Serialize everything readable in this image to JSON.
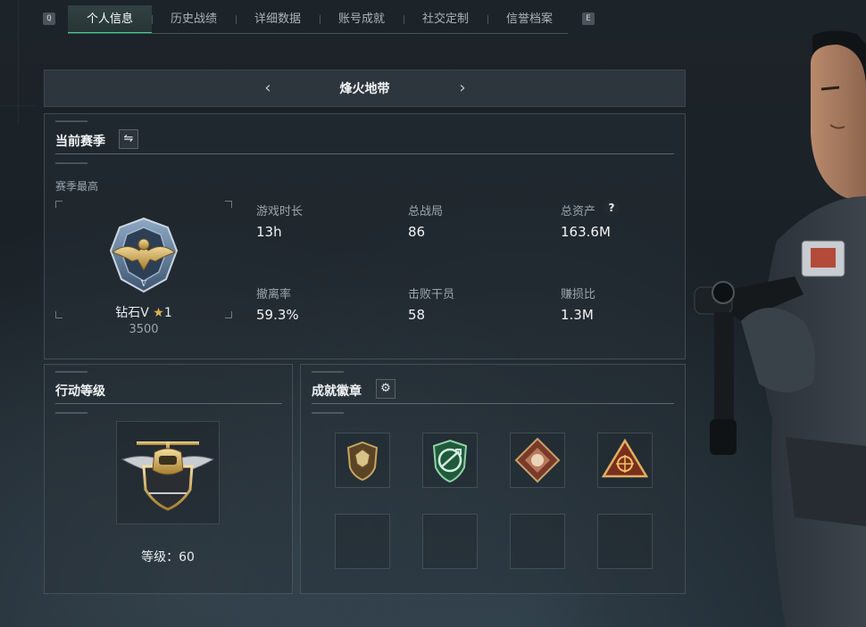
{
  "tabs": {
    "left_key": "Q",
    "right_key": "E",
    "items": [
      "个人信息",
      "历史战绩",
      "详细数据",
      "账号成就",
      "社交定制",
      "信誉档案"
    ],
    "active_index": 0
  },
  "mode": {
    "title": "烽火地带",
    "prev_icon": "chevron-left-icon",
    "next_icon": "chevron-right-icon"
  },
  "season": {
    "title": "当前赛季",
    "switch_icon": "swap-icon",
    "best_label": "赛季最高",
    "rank_name": "钻石V",
    "rank_star": "★",
    "rank_stars": "1",
    "rank_score": "3500",
    "stats": [
      {
        "label": "游戏时长",
        "value": "13h"
      },
      {
        "label": "总战局",
        "value": "86"
      },
      {
        "label": "总资产",
        "value": "163.6M"
      },
      {
        "label": "撤离率",
        "value": "59.3%"
      },
      {
        "label": "击败干员",
        "value": "58"
      },
      {
        "label": "赚损比",
        "value": "1.3M"
      }
    ],
    "help_icon_text": "?"
  },
  "action_level": {
    "title": "行动等级",
    "level_text": "等级：60"
  },
  "badges": {
    "title": "成就徽章",
    "settings_icon": "gear-icon",
    "items": [
      "shield-badge-icon",
      "circle-arrows-badge-icon",
      "beast-diamond-badge-icon",
      "target-triangle-badge-icon"
    ]
  },
  "colors": {
    "accent": "#3fd08a",
    "gold": "#d9b452"
  }
}
